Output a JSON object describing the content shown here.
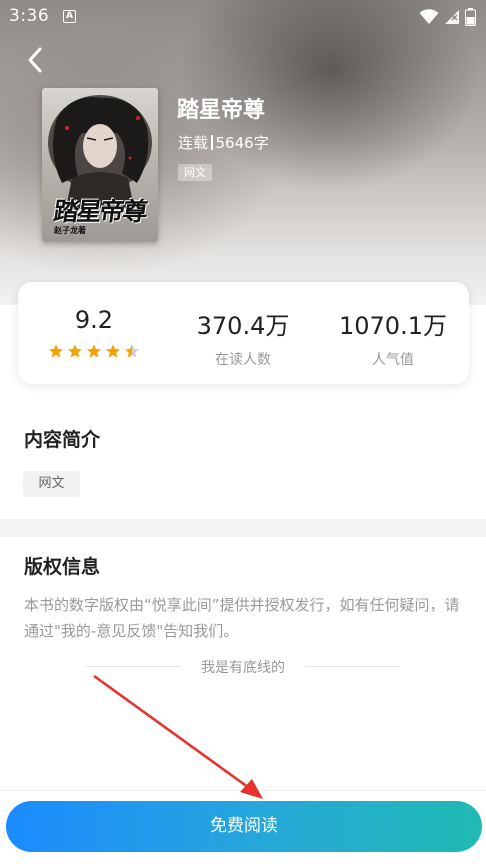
{
  "status_bar": {
    "time": "3:36",
    "notification_icon": "a-letter-icon",
    "icons": [
      "wifi-icon",
      "cellular-off-icon",
      "battery-icon"
    ]
  },
  "nav": {
    "back_icon": "chevron-left-icon"
  },
  "book": {
    "title": "踏星帝尊",
    "status": "连载",
    "word_count": "5646字",
    "tag": "网文",
    "cover_title": "踏星帝尊",
    "cover_author": "赵子龙著"
  },
  "stats": {
    "rating": "9.2",
    "stars": 4.5,
    "readers_value": "370.4万",
    "readers_label": "在读人数",
    "popularity_value": "1070.1万",
    "popularity_label": "人气值"
  },
  "intro": {
    "title": "内容简介",
    "tag": "网文"
  },
  "copyright": {
    "title": "版权信息",
    "text": "本书的数字版权由“悦享此间”提供并授权发行，如有任何疑问，请通过\"我的-意见反馈\"告知我们。",
    "end_note": "我是有底线的"
  },
  "actions": {
    "read_label": "免费阅读"
  },
  "colors": {
    "star": "#f5a300",
    "button_start": "#1b8bff",
    "button_end": "#1fbab2",
    "annotation_arrow": "#e8322b"
  }
}
